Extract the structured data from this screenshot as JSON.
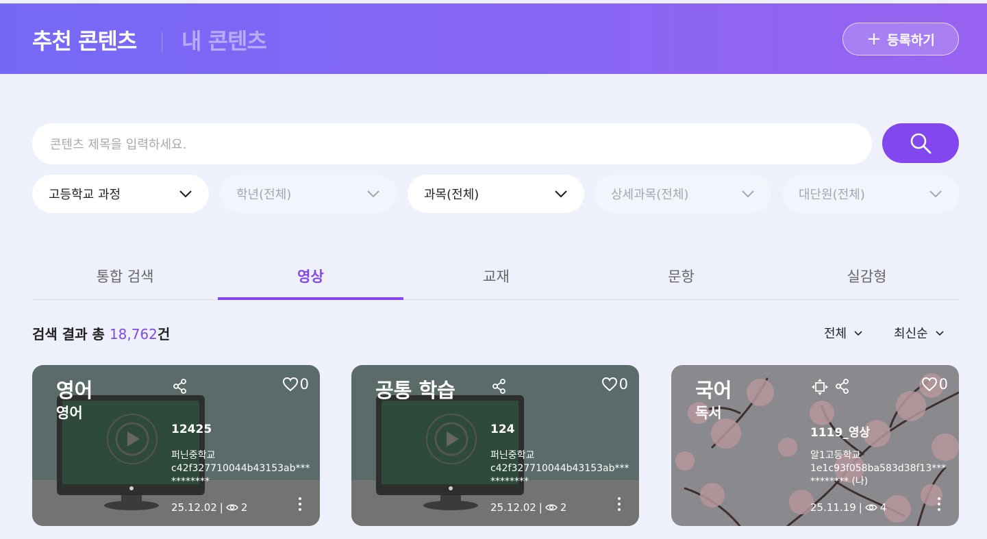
{
  "header": {
    "tab_recommended": "추천 콘텐츠",
    "tab_mine": "내 콘텐츠",
    "register_label": "등록하기"
  },
  "search": {
    "placeholder": "콘텐츠 제목을 입력하세요."
  },
  "filters": [
    {
      "label": "고등학교 과정",
      "state": "active"
    },
    {
      "label": "학년(전체)",
      "state": "disabled"
    },
    {
      "label": "과목(전체)",
      "state": "active"
    },
    {
      "label": "상세과목(전체)",
      "state": "disabled"
    },
    {
      "label": "대단원(전체)",
      "state": "disabled"
    }
  ],
  "tabs": [
    {
      "label": "통합 검색"
    },
    {
      "label": "영상",
      "selected": true
    },
    {
      "label": "교재"
    },
    {
      "label": "문항"
    },
    {
      "label": "실감형"
    }
  ],
  "results": {
    "prefix": "검색 결과 총 ",
    "count": "18,762",
    "suffix": "건"
  },
  "sort": {
    "filter_label": "전체",
    "order_label": "최신순"
  },
  "cards": [
    {
      "subject": "영어",
      "detail": "영어",
      "likes": "0",
      "name": "12425",
      "school": "퍼닌중학교",
      "owner": "c42f327710044b43153ab***********",
      "date": "25.12.02",
      "views": "2",
      "thumbnail": "monitor-play"
    },
    {
      "subject": "공통 학습",
      "detail": "",
      "likes": "0",
      "name": "124",
      "school": "퍼닌중학교",
      "owner": "c42f327710044b43153ab***********",
      "date": "25.12.02",
      "views": "2",
      "thumbnail": "monitor-play"
    },
    {
      "subject": "국어",
      "detail": "독서",
      "likes": "0",
      "name": "1119_영상",
      "school": "알1고등학교",
      "owner": "1e1c93f058ba583d38f13***********",
      "owner_suffix": "(나)",
      "date": "25.11.19",
      "views": "4",
      "thumbnail": "cherry-blossom"
    }
  ],
  "colors": {
    "accent": "#8247ef",
    "header_gradient_start": "#7668f6",
    "header_gradient_end": "#9863f0",
    "page_bg": "#eef1fb"
  }
}
